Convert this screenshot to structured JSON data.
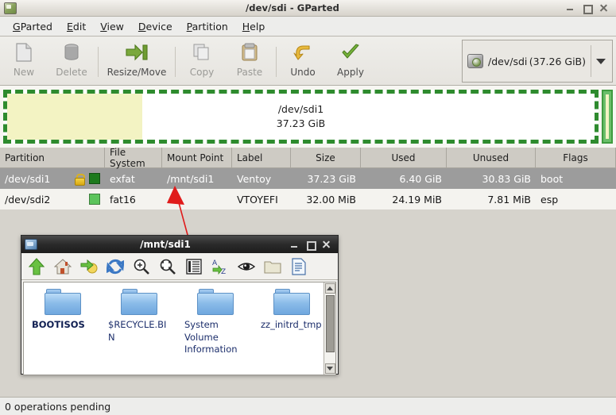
{
  "window": {
    "title": "/dev/sdi - GParted",
    "icon": "gparted-icon",
    "minimize": "minimize",
    "maximize": "maximize",
    "close": "close"
  },
  "menubar": {
    "items": [
      {
        "label": "GParted",
        "mnemonic": "G"
      },
      {
        "label": "Edit",
        "mnemonic": "E"
      },
      {
        "label": "View",
        "mnemonic": "V"
      },
      {
        "label": "Device",
        "mnemonic": "D"
      },
      {
        "label": "Partition",
        "mnemonic": "P"
      },
      {
        "label": "Help",
        "mnemonic": "H"
      }
    ]
  },
  "toolbar": {
    "buttons": [
      {
        "label": "New",
        "icon": "new-document-icon",
        "enabled": false
      },
      {
        "label": "Delete",
        "icon": "delete-icon",
        "enabled": false
      },
      {
        "label": "Resize/Move",
        "icon": "resize-move-icon",
        "enabled": true
      },
      {
        "label": "Copy",
        "icon": "copy-icon",
        "enabled": false
      },
      {
        "label": "Paste",
        "icon": "paste-icon",
        "enabled": false
      },
      {
        "label": "Undo",
        "icon": "undo-icon",
        "enabled": true
      },
      {
        "label": "Apply",
        "icon": "apply-checkmark-icon",
        "enabled": true
      }
    ]
  },
  "device_selector": {
    "icon": "hard-disk-icon",
    "name": "/dev/sdi",
    "size": "(37.26 GiB)",
    "dropdown": "chevron-down-icon"
  },
  "graphic": {
    "primary": {
      "name": "/dev/sdi1",
      "size": "37.23 GiB",
      "used_fraction": 0.23,
      "border_color": "#2e8b2e",
      "used_color": "#f3f3c3"
    },
    "secondary": {
      "name": "/dev/sdi2",
      "fill_color": "#6abf6a"
    }
  },
  "partition_table": {
    "columns": [
      "Partition",
      "File System",
      "Mount Point",
      "Label",
      "Size",
      "Used",
      "Unused",
      "Flags"
    ],
    "rows": [
      {
        "partition": "/dev/sdi1",
        "locked": true,
        "swatch": "#1d7a1d",
        "filesystem": "exfat",
        "mount_point": "/mnt/sdi1",
        "label": "Ventoy",
        "size": "37.23 GiB",
        "used": "6.40 GiB",
        "unused": "30.83 GiB",
        "flags": "boot",
        "selected": true
      },
      {
        "partition": "/dev/sdi2",
        "locked": false,
        "swatch": "#5cc45c",
        "filesystem": "fat16",
        "mount_point": "",
        "label": "VTOYEFI",
        "size": "32.00 MiB",
        "used": "24.19 MiB",
        "unused": "7.81 MiB",
        "flags": "esp",
        "selected": false
      }
    ]
  },
  "statusbar": {
    "text": "0 operations pending"
  },
  "file_manager": {
    "title": "/mnt/sdi1",
    "icon": "file-manager-icon",
    "minimize": "minimize",
    "maximize": "maximize",
    "close": "close",
    "toolbar_icons": [
      "up-arrow-icon",
      "home-icon",
      "go-to-icon",
      "refresh-icon",
      "zoom-in-icon",
      "zoom-fit-icon",
      "list-view-icon",
      "sort-az-icon",
      "show-hidden-eye-icon",
      "open-folder-icon",
      "new-document-icon"
    ],
    "items": [
      {
        "name": "BOOTISOS",
        "type": "folder",
        "bold": true
      },
      {
        "name": "$RECYCLE.BIN",
        "type": "folder",
        "bold": false
      },
      {
        "name": "System Volume Information",
        "type": "folder",
        "bold": false
      },
      {
        "name": "zz_initrd_tmp",
        "type": "folder",
        "bold": false
      }
    ],
    "scrollbar": {
      "up": "scroll-up-arrow",
      "down": "scroll-down-arrow"
    }
  },
  "annotation": {
    "color": "#e01b1b",
    "points_to": "/mnt/sdi1"
  }
}
